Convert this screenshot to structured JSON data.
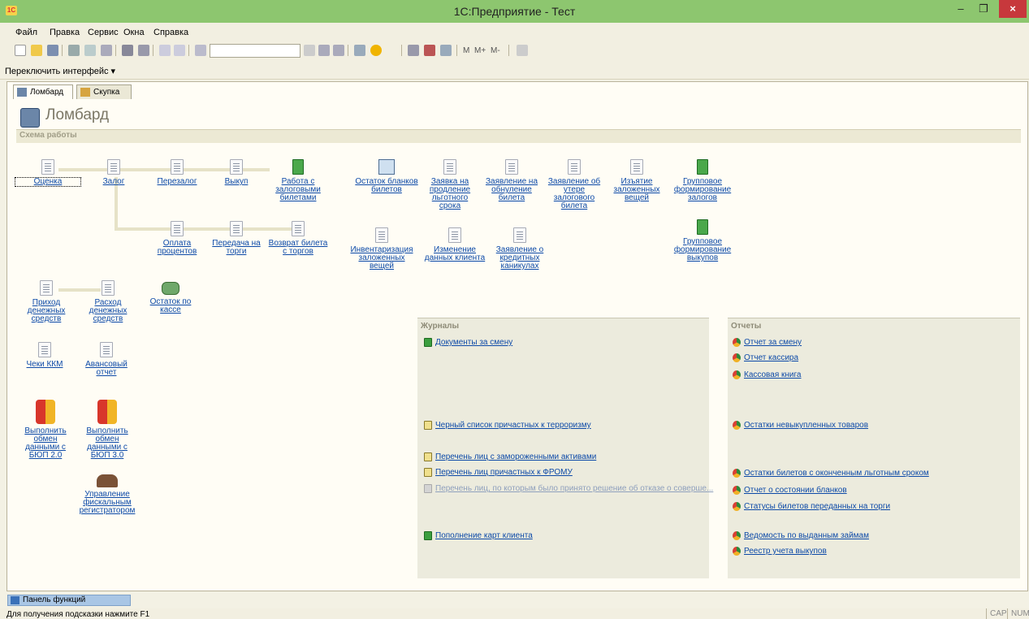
{
  "window": {
    "title": "1С:Предприятие - Тест",
    "app_icon": "1С",
    "minimize": "–",
    "maximize": "❐",
    "close": "×"
  },
  "menu": [
    {
      "label": "Файл"
    },
    {
      "label": "Правка"
    },
    {
      "label": "Сервис"
    },
    {
      "label": "Окна"
    },
    {
      "label": "Справка"
    }
  ],
  "toolbar": {
    "search_value": "",
    "memory": [
      "M",
      "M+",
      "M-"
    ]
  },
  "interface_switch": "Переключить интерфейс ▾",
  "tabs": [
    {
      "label": "Ломбард",
      "icon": "table-icon"
    },
    {
      "label": "Скупка",
      "icon": "folder-icon"
    }
  ],
  "page": {
    "title": "Ломбард",
    "section": "Схема работы"
  },
  "schema": {
    "row1": [
      {
        "label": "Оценка",
        "icon": "document-icon"
      },
      {
        "label": "Залог",
        "icon": "document-icon"
      },
      {
        "label": "Перезалог",
        "icon": "document-icon"
      },
      {
        "label": "Выкуп",
        "icon": "document-icon"
      },
      {
        "label": "Работа с залоговыми билетами",
        "icon": "book-icon"
      },
      {
        "label": "Остаток бланков билетов",
        "icon": "report-image-icon"
      },
      {
        "label": "Заявка на продление льготного срока",
        "icon": "document-icon"
      },
      {
        "label": "Заявление на обнуление билета",
        "icon": "document-icon"
      },
      {
        "label": "Заявление об утере залогового билета",
        "icon": "document-icon"
      },
      {
        "label": "Изъятие заложенных вещей",
        "icon": "document-icon"
      },
      {
        "label": "Групповое формирование залогов",
        "icon": "book-icon"
      }
    ],
    "row2": [
      {
        "label": "Оплата процентов",
        "icon": "document-icon"
      },
      {
        "label": "Передача на торги",
        "icon": "document-icon"
      },
      {
        "label": "Возврат билета с торгов",
        "icon": "document-icon"
      },
      {
        "label": "Инвентаризация заложенных вещей",
        "icon": "document-icon"
      },
      {
        "label": "Изменение данных клиента",
        "icon": "document-icon"
      },
      {
        "label": "Заявление о кредитных каникулах",
        "icon": "document-icon"
      },
      {
        "label": "Групповое формирование выкупов",
        "icon": "book-icon"
      }
    ],
    "left": [
      {
        "label": "Приход денежных средств",
        "icon": "document-icon"
      },
      {
        "label": "Расход денежных средств",
        "icon": "document-icon"
      },
      {
        "label": "Остаток по кассе",
        "icon": "money-icon"
      },
      {
        "label": "Чеки ККМ",
        "icon": "document-icon"
      },
      {
        "label": "Авансовый отчет",
        "icon": "document-icon"
      },
      {
        "label": "Выполнить обмен данными с БЮП 2.0",
        "icon": "exchange-icon"
      },
      {
        "label": "Выполнить обмен данными с БЮП 3.0",
        "icon": "exchange-icon"
      },
      {
        "label": "Управление фискальным регистратором",
        "icon": "fiscal-device-icon"
      }
    ]
  },
  "journals": {
    "title": "Журналы",
    "items": [
      {
        "label": "Документы за смену",
        "enabled": true
      },
      {
        "label": "Черный список причастных к терроризму",
        "enabled": true
      },
      {
        "label": "Перечень лиц с замороженными активами",
        "enabled": true
      },
      {
        "label": "Перечень лиц причастных к ФРОМУ",
        "enabled": true
      },
      {
        "label": "Перечень лиц, по которым было принято решение об отказе о соверше...",
        "enabled": false
      },
      {
        "label": "Пополнение карт клиента",
        "enabled": true
      }
    ]
  },
  "reports": {
    "title": "Отчеты",
    "items": [
      {
        "label": "Отчет за смену"
      },
      {
        "label": "Отчет кассира"
      },
      {
        "label": "Кассовая книга"
      },
      {
        "label": "Остатки невыкупленных товаров"
      },
      {
        "label": "Остатки билетов с оконченным льготным сроком"
      },
      {
        "label": "Отчет о состоянии бланков"
      },
      {
        "label": "Статусы билетов переданных на торги"
      },
      {
        "label": "Ведомость по выданным займам"
      },
      {
        "label": "Реестр учета выкупов"
      }
    ]
  },
  "function_panel": "Панель функций",
  "status": {
    "hint": "Для получения подсказки нажмите F1",
    "cap": "CAP",
    "num": "NUM"
  }
}
